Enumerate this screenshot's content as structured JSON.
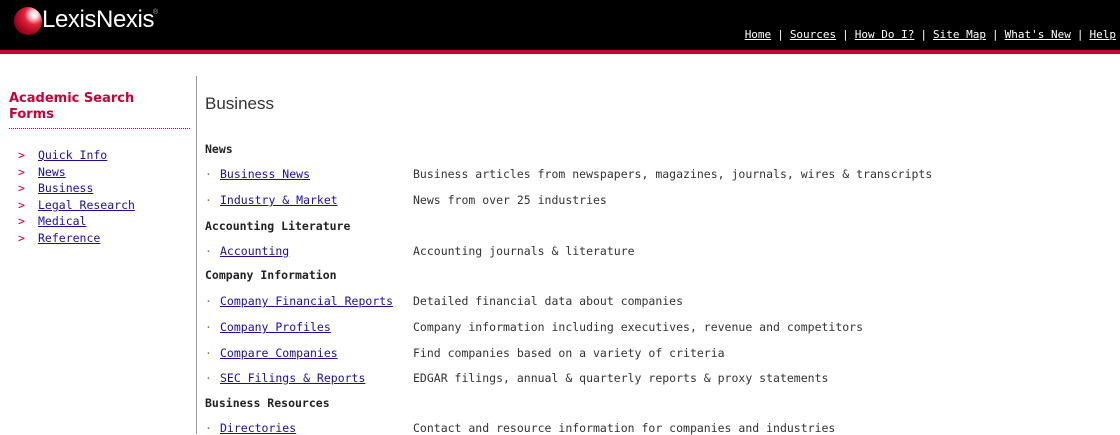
{
  "header": {
    "logo_text": "LexisNexis",
    "logo_reg": "®",
    "nav": [
      "Home",
      "Sources",
      "How Do I?",
      "Site Map",
      "What's New",
      "Help"
    ],
    "bg_color": "#000000",
    "accent_color": "#cc0033"
  },
  "sidebar": {
    "title": "Academic Search Forms",
    "items": [
      "Quick Info",
      "News",
      "Business",
      "Legal Research",
      "Medical",
      "Reference"
    ]
  },
  "main": {
    "title": "Business",
    "sections": [
      {
        "heading": "News",
        "links": [
          {
            "label": "Business News",
            "desc": "Business articles from newspapers, magazines, journals, wires & transcripts"
          },
          {
            "label": "Industry & Market",
            "desc": "News from over 25 industries"
          }
        ]
      },
      {
        "heading": "Accounting Literature",
        "links": [
          {
            "label": "Accounting",
            "desc": "Accounting journals & literature"
          }
        ]
      },
      {
        "heading": "Company Information",
        "links": [
          {
            "label": "Company Financial Reports",
            "desc": "Detailed financial data about companies"
          },
          {
            "label": "Company Profiles",
            "desc": "Company information including executives, revenue and competitors"
          },
          {
            "label": "Compare Companies",
            "desc": "Find companies based on a variety of criteria"
          },
          {
            "label": "SEC Filings & Reports",
            "desc": "EDGAR filings, annual & quarterly reports & proxy statements"
          }
        ]
      },
      {
        "heading": "Business Resources",
        "links": [
          {
            "label": "Directories",
            "desc": "Contact and resource information for companies and industries"
          }
        ]
      }
    ]
  }
}
